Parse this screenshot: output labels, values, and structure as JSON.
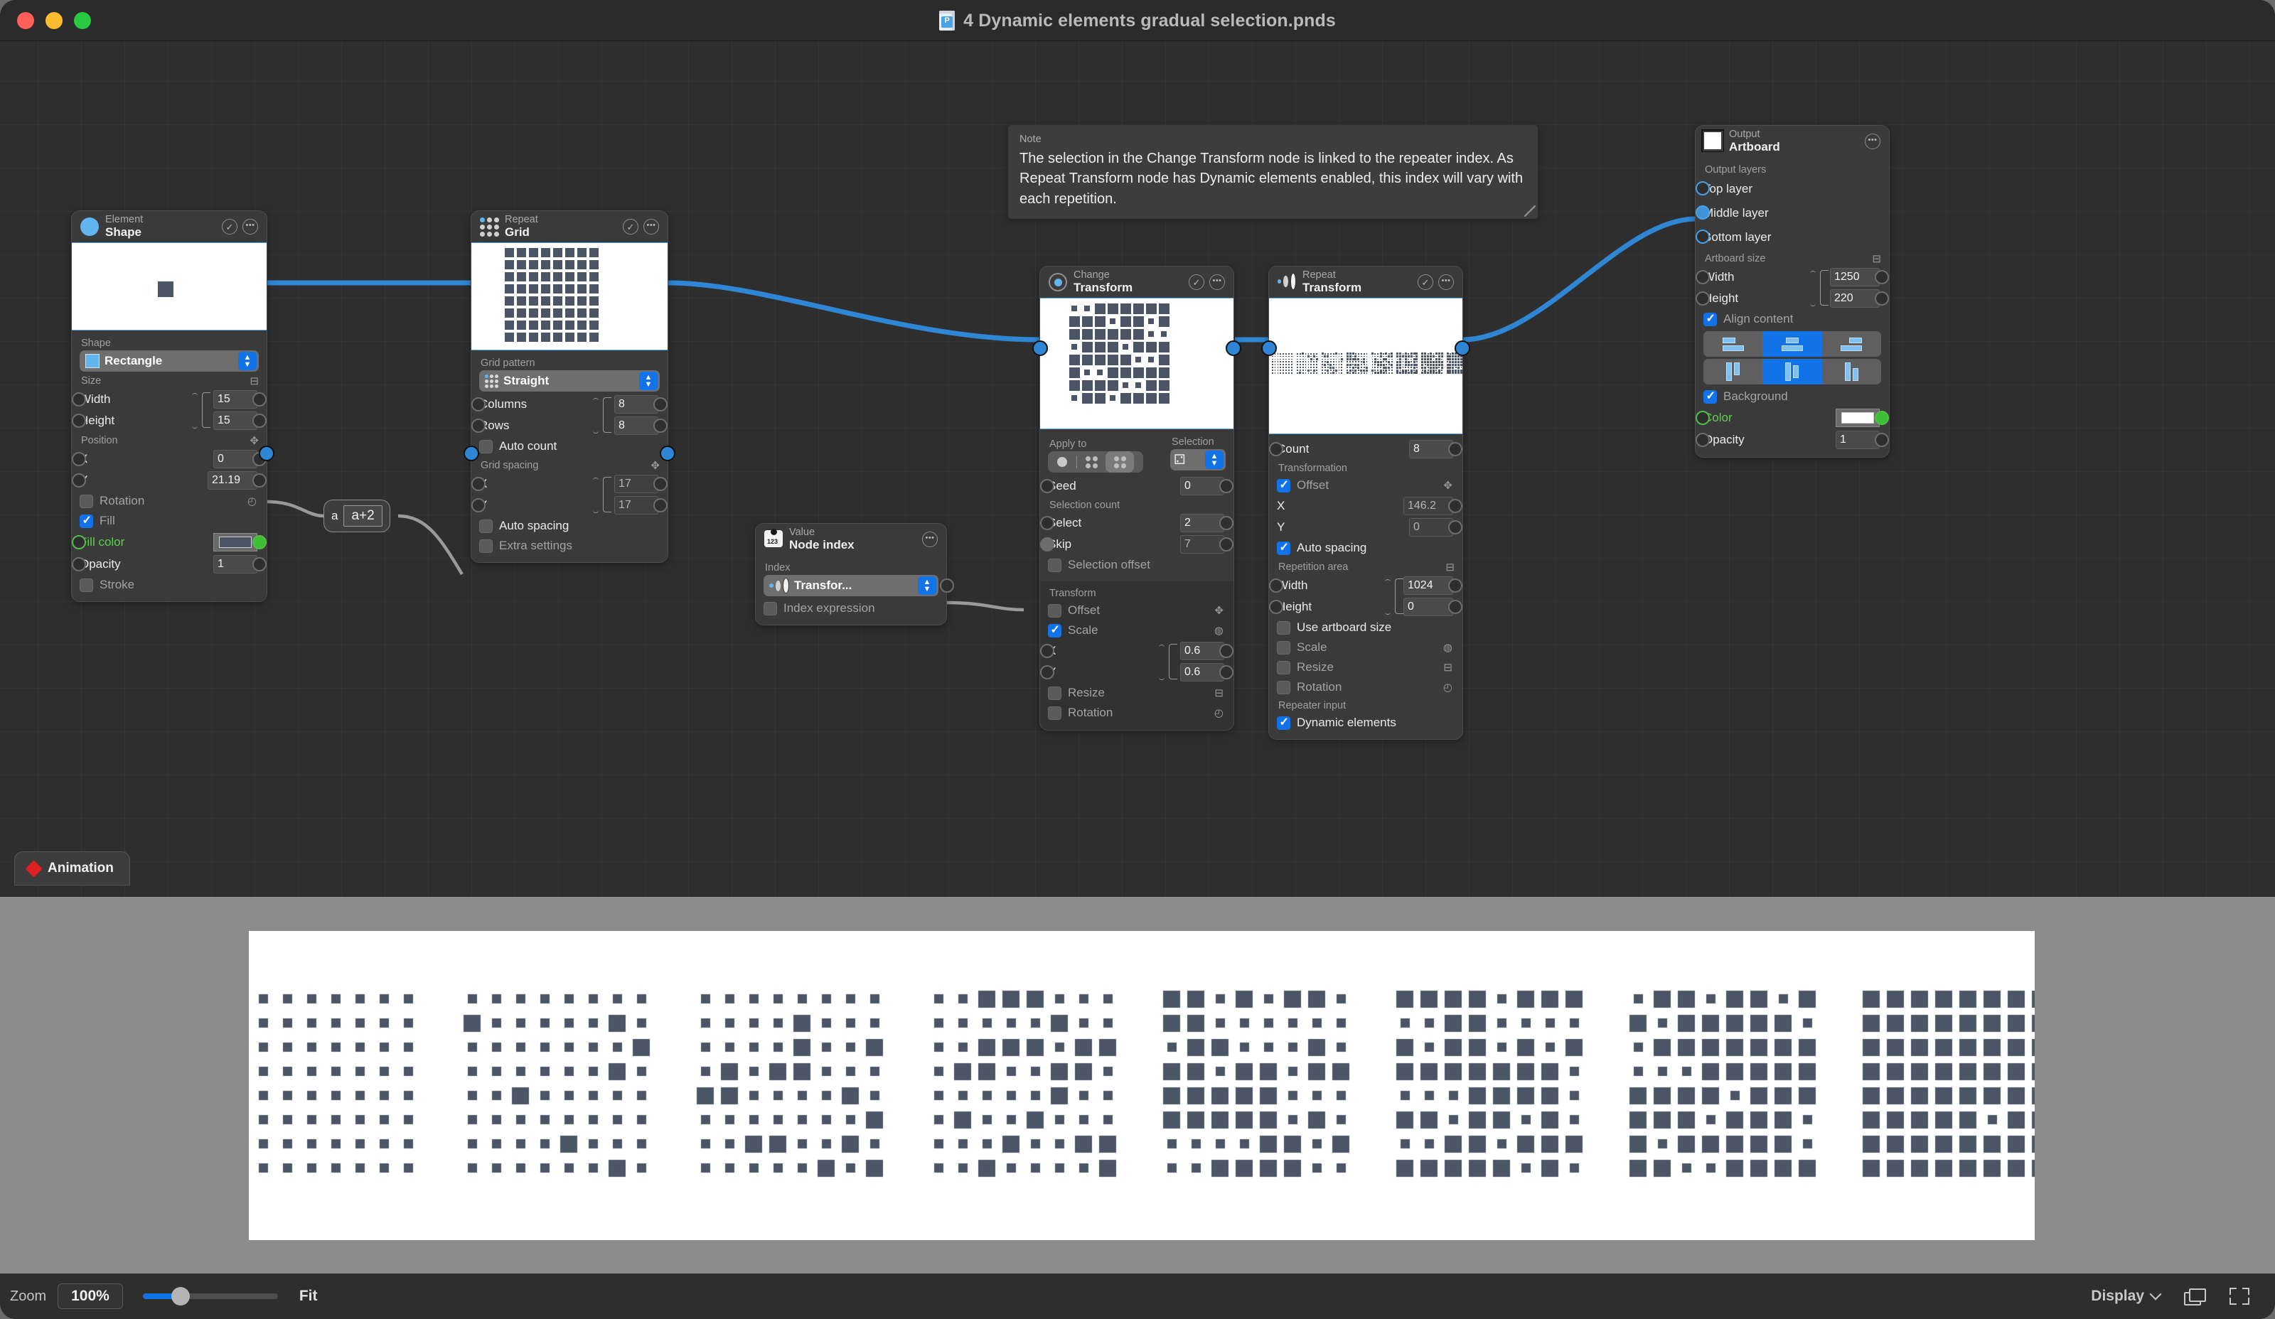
{
  "window": {
    "title": "4 Dynamic elements gradual selection.pnds",
    "doc_badge": "P",
    "traffic": [
      "close",
      "minimize",
      "zoom"
    ]
  },
  "note": {
    "label": "Note",
    "body": "The selection in the Change Transform node is linked to the repeater index. As Repeat Transform node has Dynamic elements enabled, this index will vary with each repetition."
  },
  "expression_node": {
    "input_label": "a",
    "expression": "a+2"
  },
  "nodes": {
    "shape": {
      "kind": "Element",
      "name": "Shape",
      "shape_label": "Shape",
      "shape_value": "Rectangle",
      "size_label": "Size",
      "width_label": "Width",
      "width_value": "15",
      "height_label": "Height",
      "height_value": "15",
      "position_label": "Position",
      "x_label": "X",
      "x_value": "0",
      "y_label": "Y",
      "y_value": "21.19",
      "rotation_label": "Rotation",
      "rotation_checked": false,
      "fill_label": "Fill",
      "fill_checked": true,
      "fill_color_label": "Fill color",
      "fill_color_hex": "#4b5565",
      "opacity_label": "Opacity",
      "opacity_value": "1",
      "stroke_label": "Stroke",
      "stroke_checked": false
    },
    "grid": {
      "kind": "Repeat",
      "name": "Grid",
      "pattern_label": "Grid pattern",
      "pattern_value": "Straight",
      "columns_label": "Columns",
      "columns_value": "8",
      "rows_label": "Rows",
      "rows_value": "8",
      "auto_count_label": "Auto count",
      "auto_count_checked": false,
      "spacing_label": "Grid spacing",
      "sx_label": "X",
      "sx_value": "17",
      "sy_label": "Y",
      "sy_value": "17",
      "auto_spacing_label": "Auto spacing",
      "auto_spacing_checked": false,
      "extra_label": "Extra settings",
      "extra_checked": false
    },
    "change_transform": {
      "kind": "Change",
      "name": "Transform",
      "apply_to_label": "Apply to",
      "selection_label": "Selection",
      "apply_to_options": [
        "single",
        "pair",
        "quad"
      ],
      "apply_to_selected": 2,
      "selection_mode_icon": "dice-icon",
      "seed_label": "Seed",
      "seed_value": "0",
      "selection_count_label": "Selection count",
      "select_label": "Select",
      "select_value": "2",
      "skip_label": "Skip",
      "skip_value": "7",
      "selection_offset_label": "Selection offset",
      "selection_offset_checked": false,
      "transform_label": "Transform",
      "offset_label": "Offset",
      "offset_checked": false,
      "scale_label": "Scale",
      "scale_checked": true,
      "scale_x_label": "X",
      "scale_x_value": "0.6",
      "scale_y_label": "Y",
      "scale_y_value": "0.6",
      "resize_label": "Resize",
      "resize_checked": false,
      "rotation_label": "Rotation",
      "rotation_checked": false
    },
    "repeat_transform": {
      "kind": "Repeat",
      "name": "Transform",
      "count_label": "Count",
      "count_value": "8",
      "transformation_label": "Transformation",
      "offset_label": "Offset",
      "offset_checked": true,
      "off_x_label": "X",
      "off_x_value": "146.2",
      "off_y_label": "Y",
      "off_y_value": "0",
      "auto_spacing_label": "Auto spacing",
      "auto_spacing_checked": true,
      "repetition_area_label": "Repetition area",
      "width_label": "Width",
      "width_value": "1024",
      "height_label": "Height",
      "height_value": "0",
      "use_artboard_label": "Use artboard size",
      "use_artboard_checked": false,
      "scale_label": "Scale",
      "scale_checked": false,
      "resize_label": "Resize",
      "resize_checked": false,
      "rotation_label": "Rotation",
      "rotation_checked": false,
      "repeater_input_label": "Repeater input",
      "dynamic_elements_label": "Dynamic elements",
      "dynamic_elements_checked": true
    },
    "node_index": {
      "kind": "Value",
      "name": "Node index",
      "index_label": "Index",
      "index_value": "Transfor...",
      "index_expression_label": "Index expression",
      "index_expression_checked": false
    },
    "artboard": {
      "kind": "Output",
      "name": "Artboard",
      "output_layers_label": "Output layers",
      "layers": [
        "Top layer",
        "Middle layer",
        "Bottom layer"
      ],
      "connected_layer": "Middle layer",
      "artboard_size_label": "Artboard size",
      "width_label": "Width",
      "width_value": "1250",
      "height_label": "Height",
      "height_value": "220",
      "align_content_label": "Align content",
      "align_content_checked": true,
      "align_vertical_selected": 1,
      "align_horizontal_selected": 1,
      "background_label": "Background",
      "background_checked": true,
      "color_label": "Color",
      "color_hex": "#ffffff",
      "opacity_label": "Opacity",
      "opacity_value": "1"
    }
  },
  "animation_tab": {
    "label": "Animation"
  },
  "statusbar": {
    "zoom_label": "Zoom",
    "zoom_value": "100%",
    "fit_label": "Fit",
    "display_label": "Display",
    "windows_icon": "windows-icon",
    "fullscreen_icon": "fullscreen-icon"
  },
  "theme": {
    "accent": "#1273e8",
    "link": "#4a9fe0",
    "green_port": "#3dbf33",
    "shape_fill": "#4b5565",
    "canvas_bg": "#2e2e2e",
    "node_bg": "#3a3a3a"
  }
}
